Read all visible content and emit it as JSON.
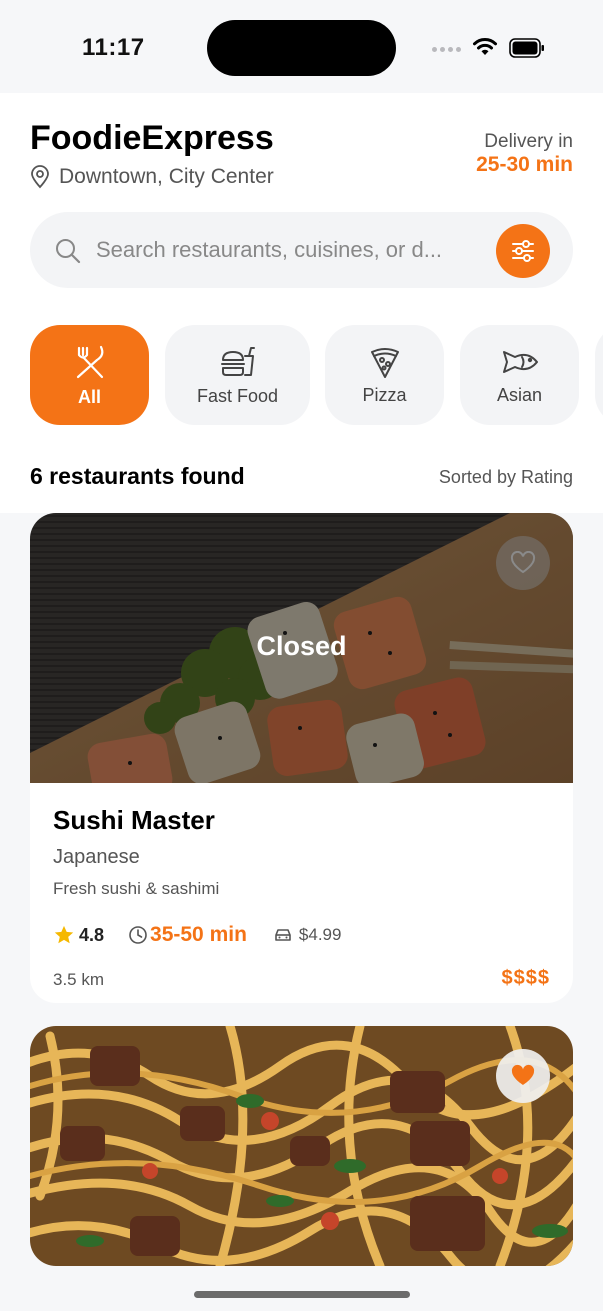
{
  "status_bar": {
    "time": "11:17"
  },
  "header": {
    "app_title": "FoodieExpress",
    "location": "Downtown, City Center",
    "delivery_label": "Delivery in",
    "delivery_time": "25-30 min"
  },
  "search": {
    "placeholder": "Search restaurants, cuisines, or d..."
  },
  "categories": [
    {
      "label": "All",
      "icon": "utensils-icon",
      "active": true
    },
    {
      "label": "Fast Food",
      "icon": "burger-icon",
      "active": false
    },
    {
      "label": "Pizza",
      "icon": "pizza-icon",
      "active": false
    },
    {
      "label": "Asian",
      "icon": "fish-icon",
      "active": false
    }
  ],
  "results": {
    "count_label": "6 restaurants found",
    "sort_label": "Sorted by Rating"
  },
  "restaurants": [
    {
      "name": "Sushi Master",
      "cuisine": "Japanese",
      "description": "Fresh sushi & sashimi",
      "rating": "4.8",
      "time": "35-50 min",
      "delivery_fee": "$4.99",
      "distance": "3.5 km",
      "price_level": "$$$$",
      "status": "Closed",
      "favorite": false
    },
    {
      "favorite": true
    }
  ],
  "colors": {
    "accent": "#f47316",
    "star": "#f5b800",
    "background": "#f6f7f9"
  }
}
